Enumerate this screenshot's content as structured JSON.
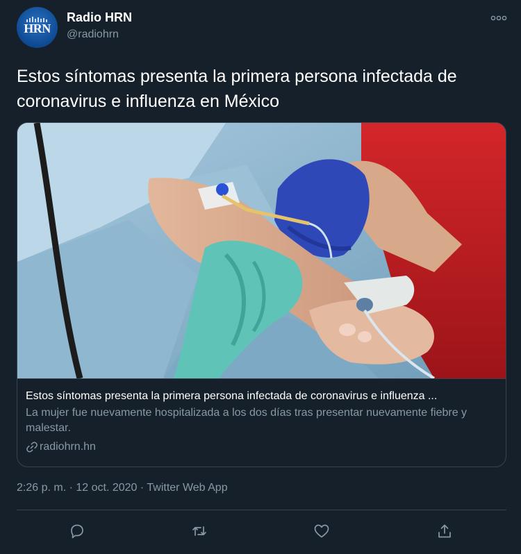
{
  "author": {
    "name": "Radio HRN",
    "handle": "@radiohrn",
    "avatar_text": "HRN",
    "avatar_icon": "hrn-logo-icon"
  },
  "tweet": {
    "text": "Estos síntomas presenta la primera persona infectada de coronavirus e influenza en México"
  },
  "card": {
    "image_icon": "hospital-patient-oximeter-photo",
    "title": "Estos síntomas presenta la primera persona infectada de coronavirus e influenza ...",
    "description": "La mujer fue nuevamente hospitalizada a los dos días tras presentar nuevamente fiebre y malestar.",
    "domain": "radiohrn.hn",
    "domain_icon": "link-icon"
  },
  "meta": {
    "time": "2:26 p. m.",
    "separator": " · ",
    "date": "12 oct. 2020",
    "app": "Twitter Web App"
  },
  "actions": [
    {
      "name": "reply",
      "icon": "reply-icon"
    },
    {
      "name": "retweet",
      "icon": "retweet-icon"
    },
    {
      "name": "like",
      "icon": "heart-icon"
    },
    {
      "name": "share",
      "icon": "share-icon"
    }
  ],
  "colors": {
    "background": "#15202b",
    "border": "#38444d",
    "secondary_text": "#8899a6",
    "primary_text": "#ffffff"
  }
}
